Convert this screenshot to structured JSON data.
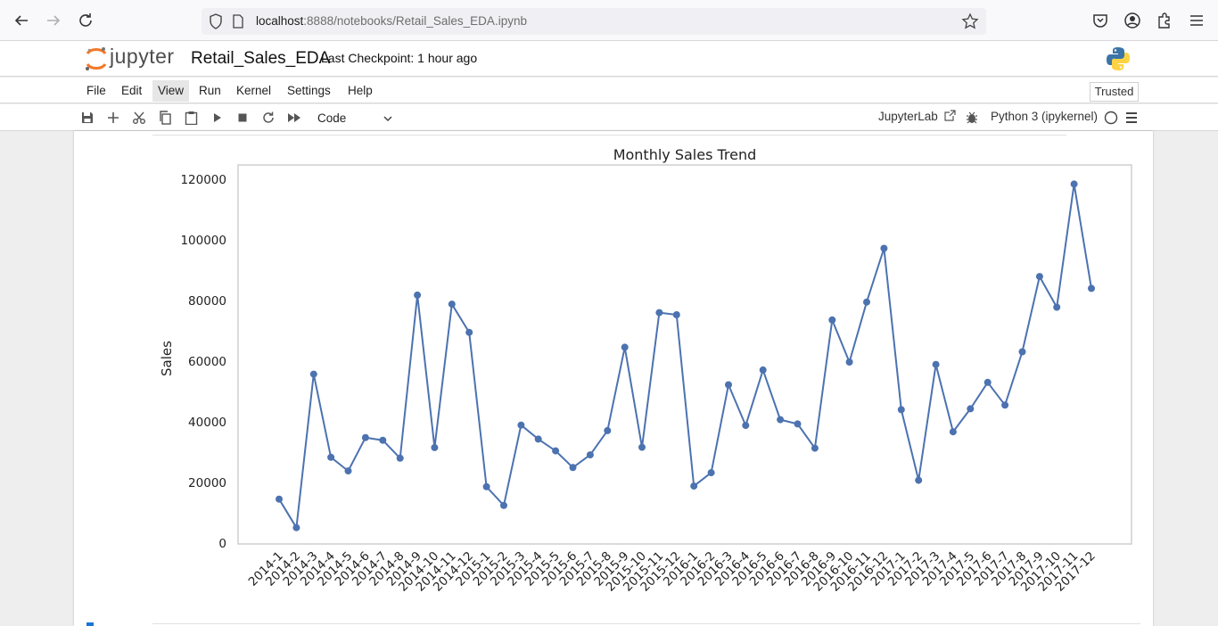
{
  "browser": {
    "url_host": "localhost",
    "url_rest": ":8888/notebooks/Retail_Sales_EDA.ipynb",
    "icons": [
      "back-arrow-icon",
      "forward-arrow-icon",
      "reload-icon",
      "shield-icon",
      "page-icon",
      "bookmark-star-icon",
      "pocket-icon",
      "account-icon",
      "extensions-icon",
      "menu-icon"
    ]
  },
  "header": {
    "logo_text": "jupyter",
    "notebook_name": "Retail_Sales_EDA",
    "checkpoint": "Last Checkpoint: 1 hour ago"
  },
  "menu": {
    "items": [
      "File",
      "Edit",
      "View",
      "Run",
      "Kernel",
      "Settings",
      "Help"
    ],
    "active": "View",
    "trusted_label": "Trusted"
  },
  "toolbar": {
    "cell_type": "Code",
    "jupyterlab_label": "JupyterLab",
    "kernel_label": "Python 3 (ipykernel)",
    "icons": [
      "save-icon",
      "add-cell-icon",
      "cut-icon",
      "copy-icon",
      "paste-icon",
      "run-icon",
      "stop-icon",
      "restart-icon",
      "run-all-icon"
    ]
  },
  "colors": {
    "line": "#4c72b0",
    "accent": "#1976d2"
  },
  "chart_data": {
    "type": "line",
    "title": "Monthly Sales Trend",
    "xlabel": "",
    "ylabel": "Sales",
    "ylim": [
      0,
      125000
    ],
    "yticks": [
      0,
      20000,
      40000,
      60000,
      80000,
      100000,
      120000
    ],
    "grid": false,
    "categories": [
      "2014-1",
      "2014-2",
      "2014-3",
      "2014-4",
      "2014-5",
      "2014-6",
      "2014-7",
      "2014-8",
      "2014-9",
      "2014-10",
      "2014-11",
      "2014-12",
      "2015-1",
      "2015-2",
      "2015-3",
      "2015-4",
      "2015-5",
      "2015-6",
      "2015-7",
      "2015-8",
      "2015-9",
      "2015-10",
      "2015-11",
      "2015-12",
      "2016-1",
      "2016-2",
      "2016-3",
      "2016-4",
      "2016-5",
      "2016-6",
      "2016-7",
      "2016-8",
      "2016-9",
      "2016-10",
      "2016-11",
      "2016-12",
      "2017-1",
      "2017-2",
      "2017-3",
      "2017-4",
      "2017-5",
      "2017-6",
      "2017-7",
      "2017-8",
      "2017-9",
      "2017-10",
      "2017-11",
      "2017-12"
    ],
    "values": [
      14500,
      5100,
      55700,
      28300,
      23800,
      34800,
      33900,
      28000,
      81800,
      31500,
      78800,
      69500,
      18600,
      12400,
      38900,
      34300,
      30400,
      24900,
      29100,
      37100,
      64600,
      31600,
      76000,
      75300,
      18800,
      23200,
      52200,
      38800,
      57100,
      40700,
      39300,
      31300,
      73600,
      59700,
      79500,
      97200,
      44000,
      20700,
      58900,
      36700,
      44300,
      53000,
      45500,
      63100,
      87900,
      77800,
      118400,
      84000
    ]
  }
}
